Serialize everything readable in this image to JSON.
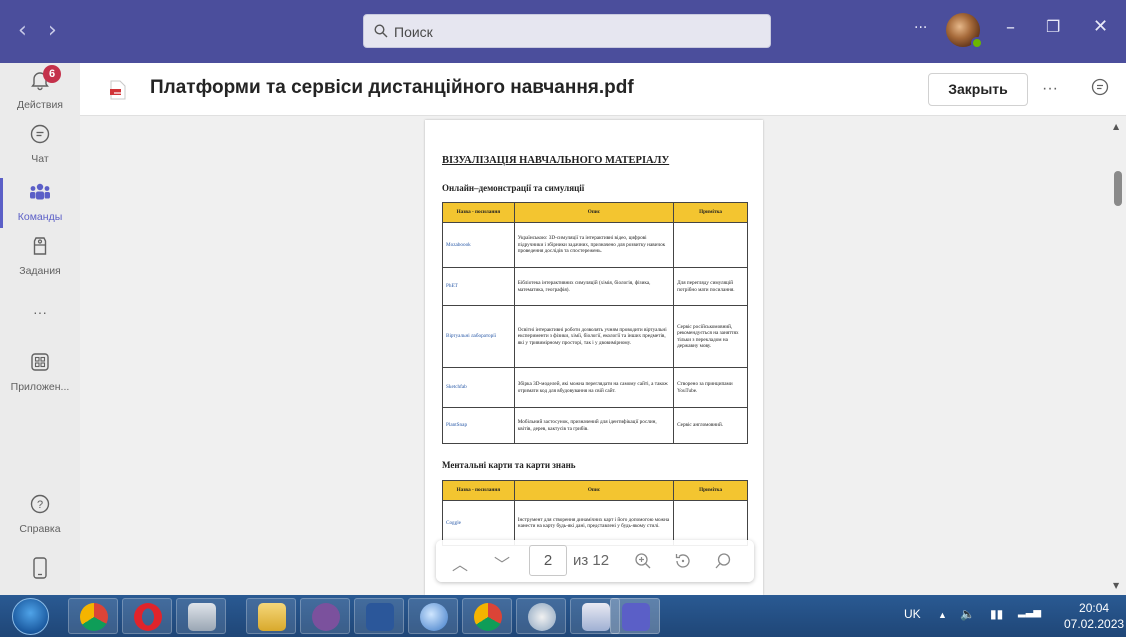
{
  "titlebar": {
    "search_placeholder": "Поиск",
    "more": "···"
  },
  "rail": {
    "activity": {
      "label": "Действия",
      "badge": "6"
    },
    "chat": {
      "label": "Чат"
    },
    "teams": {
      "label": "Команды"
    },
    "assignments": {
      "label": "Задания"
    },
    "more": "···",
    "apps": {
      "label": "Приложен..."
    },
    "help": {
      "label": "Справка"
    }
  },
  "header": {
    "file_title": "Платформи та сервіси дистанційного навчання.pdf",
    "close_label": "Закрыть",
    "more": "···"
  },
  "document": {
    "heading": "ВІЗУАЛІЗАЦІЯ НАВЧАЛЬНОГО МАТЕРІАЛУ",
    "section1": "Онлайн–демонстрації та симуляції",
    "table_headers": [
      "Назва - посилання",
      "Опис",
      "Примітка"
    ],
    "table1": [
      {
        "name": "Mozaboook",
        "desc": "Українською: 3D-симуляції та інтерактивні відео, цифрові підручники і збірники задачних, призначено для розвитку навичок проведення дослідів та спостережень.",
        "note": ""
      },
      {
        "name": "PhET",
        "desc": "Бібліотека інтерактивних симуляцій (хімія, біологія, фізика, математика, географія).",
        "note": "Для перегляду симуляцій потрібно мати посилання."
      },
      {
        "name": "Віртуальні лабораторії",
        "desc": "Освітні інтерактивні роботи дозволять учням проводити віртуальні експерименти з фізики, хімії, біології, екології та інших предметів, які у тривимірному просторі, так і у двовимірному.",
        "note": "Сервіс російськомовний, рекомендується на заняттях тільки з перекладом на державну мову."
      },
      {
        "name": "Sketchfab",
        "desc": "Збірка 3D-моделей, які можна переглядати на самому сайті, а також отримати код для вбудовування на свій сайт.",
        "note": "Створено за принципами YouTube."
      },
      {
        "name": "PlantSnap",
        "desc": "Мобільний застосунок, призначений для ідентифікації рослин, квітів, дерев, кактусів та грибів.",
        "note": "Сервіс англомовний."
      }
    ],
    "section2": "Ментальні карти та карти знань",
    "table2": [
      {
        "name": "Coggle",
        "desc": "Інструмент для створення динамічних карт і його допомогою можна нанести на карту будь-які дані, представлені у будь-якому стилі.",
        "note": ""
      }
    ]
  },
  "page_toolbar": {
    "current_page": "2",
    "of_label": "из 12"
  },
  "tray": {
    "lang": "UK",
    "time": "20:04",
    "date": "07.02.2023"
  }
}
